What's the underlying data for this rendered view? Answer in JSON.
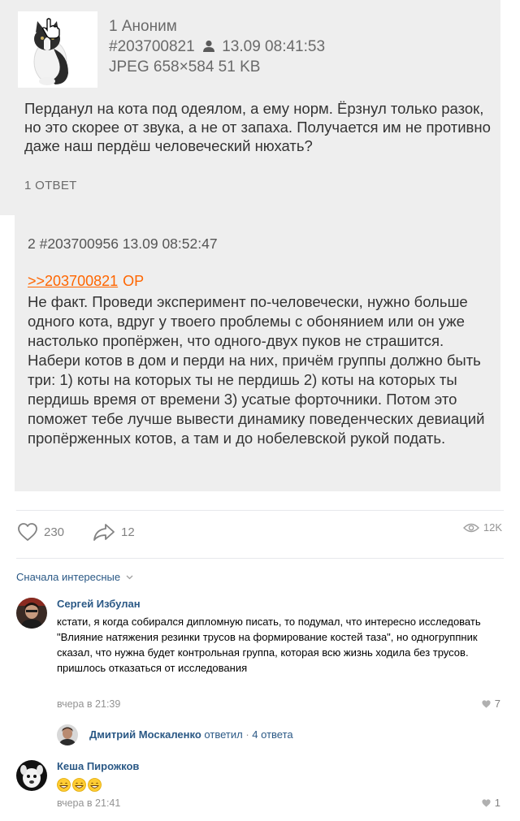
{
  "post": {
    "post1": {
      "number": "1",
      "author": "Аноним",
      "id": "#203700821",
      "datetime": "13.09 08:41:53",
      "file_info": "JPEG 658×584 51 KB",
      "text": "Перданул на кота под одеялом, а ему норм. Ёрзнул только разок, но это скорее от звука, а не от запаха. Получается им не противно даже наш пердёш человеческий нюхать?",
      "replies": "1 ОТВЕТ"
    },
    "post2": {
      "header": "2 #203700956 13.09 08:52:47",
      "reply_link": ">>203700821",
      "op_label": "OP",
      "text": "Не факт. Проведи эксперимент по-человечески, нужно больше одного кота, вдруг у твоего проблемы с обонянием или он уже настолько пропёржен, что одного-двух пуков не страшится. Набери котов в дом и перди на них, причём группы должно быть три: 1) коты на которых ты не пердишь 2) коты на которых ты пердишь время от времени 3) усатые форточники. Потом это поможет тебе лучше вывести динамику поведенческих девиаций пропёрженных котов, а там и до нобелевской рукой подать."
    },
    "actions": {
      "likes": "230",
      "shares": "12",
      "views": "12K"
    }
  },
  "comments": {
    "sort_label": "Сначала интересные",
    "items": [
      {
        "author": "Сергей Избулан",
        "text": "кстати, я когда собирался дипломную писать, то подумал, что интересно исследовать \"Влияние натяжения резинки трусов на формирование костей таза\", но одногруппник сказал, что нужна будет контрольная группа, которая всю жизнь ходила без трусов. пришлось отказаться от исследования",
        "date": "вчера в 21:39",
        "likes": "7"
      },
      {
        "author": "Кеша Пирожков",
        "emoji_count": 3,
        "date": "вчера в 21:41",
        "likes": "1"
      }
    ],
    "thread": {
      "name": "Дмитрий Москаленко",
      "action": "ответил",
      "separator": "·",
      "count": "4 ответа"
    }
  },
  "colors": {
    "link": "#2a5885",
    "orange": "#ff6600",
    "post_bg": "#eeeeee",
    "muted": "#939393"
  },
  "icons": [
    "cursor-hand-icon",
    "user-icon",
    "heart-icon",
    "share-icon",
    "eye-icon",
    "chevron-down-icon",
    "grin-emoji-icon"
  ]
}
